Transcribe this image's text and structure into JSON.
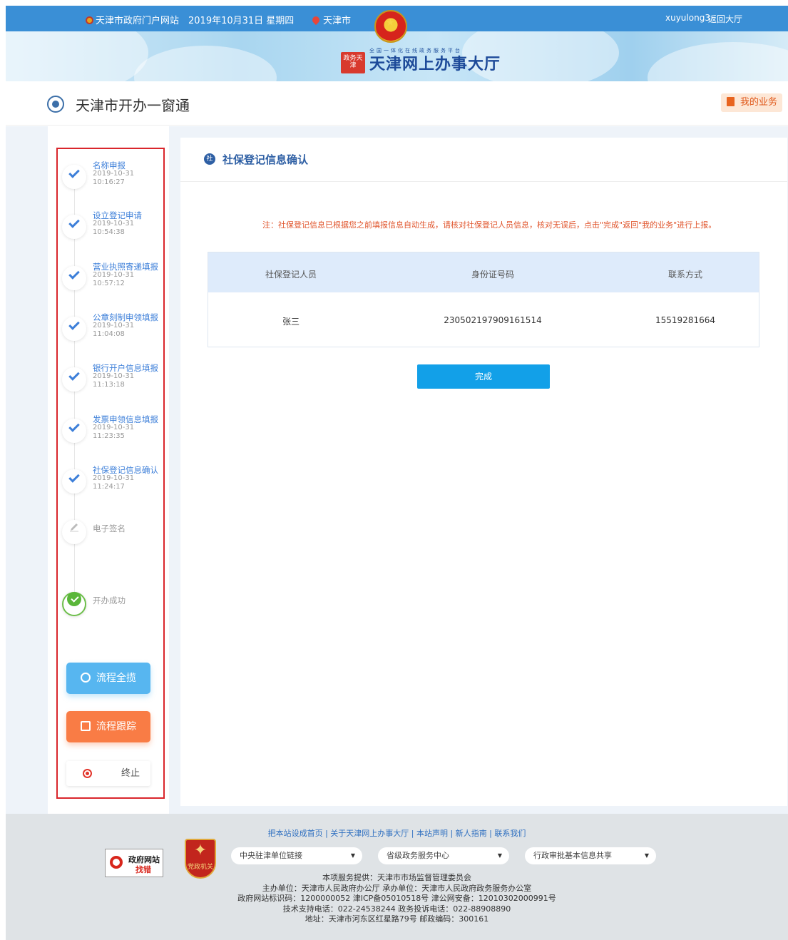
{
  "topbar": {
    "portal": "天津市政府门户网站",
    "date": "2019年10月31日 星期四",
    "city": "天津市",
    "username": "xuyulong3",
    "back_label": "返回大厅"
  },
  "banner": {
    "subtitle": "全国一体化在线政务服务平台",
    "seal_text": "政务天津",
    "brand_name": "天津网上办事大厅"
  },
  "header": {
    "app_title": "天津市开办一窗通",
    "my_business": "我的业务"
  },
  "steps": [
    {
      "label": "名称申报",
      "date": "2019-10-31",
      "time": "10:16:27",
      "status": "done"
    },
    {
      "label": "设立登记申请",
      "date": "2019-10-31",
      "time": "10:54:38",
      "status": "done"
    },
    {
      "label": "营业执照寄递填报",
      "date": "2019-10-31",
      "time": "10:57:12",
      "status": "done"
    },
    {
      "label": "公章刻制申领填报",
      "date": "2019-10-31",
      "time": "11:04:08",
      "status": "done"
    },
    {
      "label": "银行开户信息填报",
      "date": "2019-10-31",
      "time": "11:13:18",
      "status": "done"
    },
    {
      "label": "发票申领信息填报",
      "date": "2019-10-31",
      "time": "11:23:35",
      "status": "done"
    },
    {
      "label": "社保登记信息确认",
      "date": "2019-10-31",
      "time": "11:24:17",
      "status": "done"
    },
    {
      "label": "电子签名",
      "status": "pending"
    },
    {
      "label": "开办成功",
      "status": "success"
    }
  ],
  "sidebar_buttons": {
    "overview": "流程全揽",
    "track": "流程跟踪",
    "stop": "终止"
  },
  "panel": {
    "badge": "社",
    "title": "社保登记信息确认",
    "note": "注：社保登记信息已根据您之前填报信息自动生成，请核对社保登记人员信息，核对无误后，点击\"完成\"返回\"我的业务\"进行上报。",
    "table": {
      "headers": [
        "社保登记人员",
        "身份证号码",
        "联系方式"
      ],
      "rows": [
        [
          "张三",
          "230502197909161514",
          "15519281664"
        ]
      ]
    },
    "done_label": "完成"
  },
  "footer": {
    "links": "把本站设成首页 | 关于天津网上办事大厅 | 本站声明 | 新人指南 | 联系我们",
    "gov_badge_line1": "政府网站",
    "gov_badge_line2": "找错",
    "party_badge": "党政机关",
    "selects": [
      "中央驻津单位链接",
      "省级政务服务中心",
      "行政审批基本信息共享"
    ],
    "info": [
      "本项服务提供：天津市市场监督管理委员会",
      "主办单位：天津市人民政府办公厅 承办单位：天津市人民政府政务服务办公室",
      "政府网站标识码：1200000052 津ICP备05010518号 津公网安备：12010302000991号",
      "技术支持电话：022-24538244 政务投诉电话：022-88908890",
      "地址：天津市河东区红星路79号 邮政编码：300161"
    ]
  },
  "colors": {
    "topbar": "#3a8fd6",
    "accent": "#2e5fa4",
    "step": "#3d7fd9",
    "note": "#e0542b",
    "done_button": "#12a0e8",
    "overview_button": "#57b6f0",
    "track_button": "#f97c45",
    "highlight_frame": "#d9262c"
  }
}
